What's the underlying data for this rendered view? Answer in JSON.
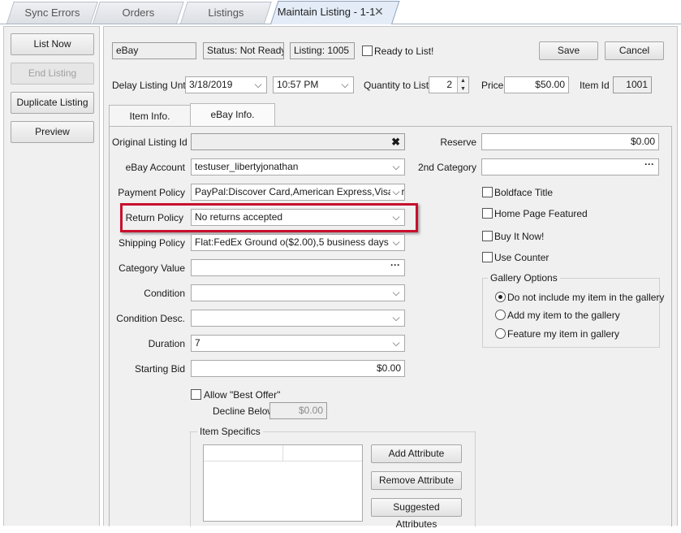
{
  "tabs": [
    {
      "label": "Sync Errors"
    },
    {
      "label": "Orders"
    },
    {
      "label": "Listings"
    },
    {
      "label": "Maintain Listing - 1-1",
      "close": "✕"
    }
  ],
  "sidebar": {
    "list_now": "List Now",
    "end_listing": "End Listing",
    "duplicate_listing": "Duplicate Listing",
    "preview": "Preview"
  },
  "header": {
    "channel": "eBay",
    "status": "Status: Not Ready",
    "listing": "Listing: 1005",
    "ready_label": "Ready to List!",
    "save": "Save",
    "cancel": "Cancel",
    "delay_label": "Delay Listing Until",
    "delay_date": "3/18/2019",
    "delay_time": "10:57 PM",
    "qty_label": "Quantity to List",
    "qty_value": "2",
    "price_label": "Price",
    "price_value": "$50.00",
    "item_id_label": "Item Id",
    "item_id_value": "1001"
  },
  "subtabs": [
    "Item Info.",
    "eBay Info."
  ],
  "form": {
    "original_listing_label": "Original Listing Id",
    "original_listing_value": "",
    "account_label": "eBay Account",
    "account_value": "testuser_libertyjonathan",
    "payment_label": "Payment Policy",
    "payment_value": "PayPal:Discover Card,American Express,Visa or",
    "return_label": "Return Policy",
    "return_value": "No returns accepted",
    "shipping_label": "Shipping Policy",
    "shipping_value": "Flat:FedEx Ground o($2.00),5 business days",
    "category_label": "Category Value",
    "category_value": "",
    "condition_label": "Condition",
    "condition_value": "",
    "condition_desc_label": "Condition Desc.",
    "condition_desc_value": "",
    "duration_label": "Duration",
    "duration_value": "7",
    "starting_bid_label": "Starting Bid",
    "starting_bid_value": "$0.00",
    "best_offer_label": "Allow \"Best Offer\"",
    "decline_label": "Decline Below",
    "decline_value": "$0.00",
    "reserve_label": "Reserve",
    "reserve_value": "$0.00",
    "second_cat_label": "2nd Category",
    "second_cat_value": "",
    "boldface": "Boldface Title",
    "home_featured": "Home Page Featured",
    "buy_now": "Buy It Now!",
    "use_counter": "Use Counter",
    "gallery_title": "Gallery Options",
    "gallery_opt1": "Do not include my item in the gallery",
    "gallery_opt2": "Add my item to the gallery",
    "gallery_opt3": "Feature my item in gallery",
    "item_specifics_title": "Item Specifics",
    "add_attr": "Add Attribute",
    "remove_attr": "Remove Attribute",
    "suggested_attr": "Suggested Attributes"
  },
  "icons": {
    "chevron": "⌵",
    "dots": "···",
    "clear": "✖",
    "spin_up": "▲",
    "spin_down": "▼"
  },
  "colors": {
    "highlight": "#c8102e",
    "active_tab": "#e4ecf7"
  }
}
